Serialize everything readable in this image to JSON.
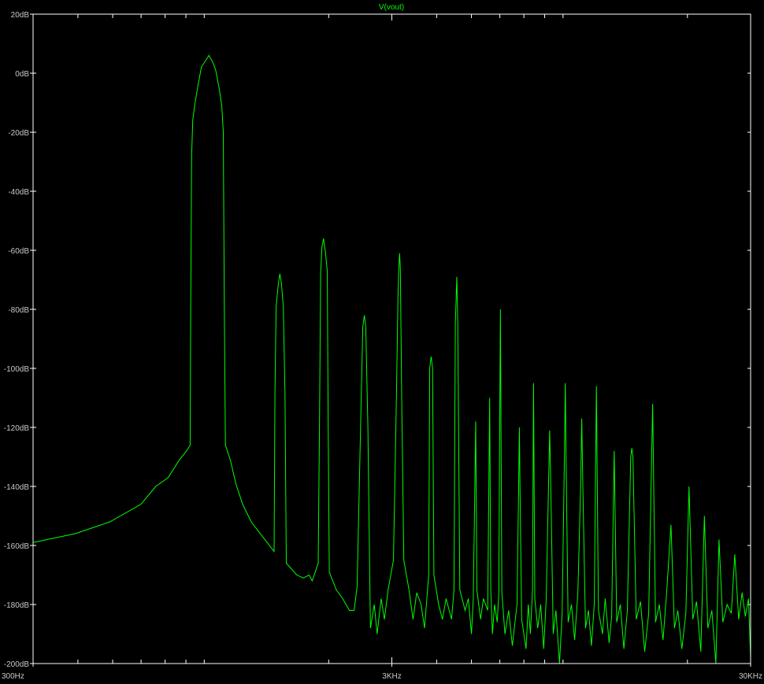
{
  "chart_data": {
    "type": "line",
    "title": "V(vout)",
    "xlabel": "",
    "ylabel": "",
    "x_scale": "log",
    "xlim": [
      300,
      30000
    ],
    "ylim": [
      -200,
      20
    ],
    "x_tick_values": [
      300,
      3000,
      30000
    ],
    "x_tick_labels": [
      "300Hz",
      "3KHz",
      "30KHz"
    ],
    "y_tick_values": [
      20,
      0,
      -20,
      -40,
      -60,
      -80,
      -100,
      -120,
      -140,
      -160,
      -180,
      -200
    ],
    "y_tick_labels": [
      "20dB",
      "0dB",
      "-20dB",
      "-40dB",
      "-60dB",
      "-80dB",
      "-100dB",
      "-120dB",
      "-140dB",
      "-160dB",
      "-180dB",
      "-200dB"
    ],
    "grid": false,
    "background": "#000000",
    "frame_color": "#ffffff",
    "line_color": "#00ff00",
    "series": [
      {
        "name": "V(vout)",
        "points": [
          [
            300,
            -159
          ],
          [
            393,
            -156
          ],
          [
            491,
            -152
          ],
          [
            600,
            -146
          ],
          [
            659,
            -140
          ],
          [
            714,
            -137
          ],
          [
            767,
            -131
          ],
          [
            803,
            -128
          ],
          [
            822,
            -126
          ],
          [
            825,
            -82
          ],
          [
            830,
            -28
          ],
          [
            836,
            -16
          ],
          [
            846,
            -11
          ],
          [
            862,
            -5
          ],
          [
            883,
            2
          ],
          [
            905,
            4
          ],
          [
            927,
            6
          ],
          [
            948,
            4
          ],
          [
            969,
            1
          ],
          [
            990,
            -5
          ],
          [
            1007,
            -11
          ],
          [
            1017,
            -20
          ],
          [
            1024,
            -83
          ],
          [
            1031,
            -126
          ],
          [
            1064,
            -131
          ],
          [
            1102,
            -139
          ],
          [
            1151,
            -146
          ],
          [
            1216,
            -152
          ],
          [
            1309,
            -157
          ],
          [
            1409,
            -162
          ],
          [
            1417,
            -108
          ],
          [
            1428,
            -79
          ],
          [
            1449,
            -71
          ],
          [
            1462,
            -68
          ],
          [
            1476,
            -71
          ],
          [
            1495,
            -79
          ],
          [
            1511,
            -108
          ],
          [
            1524,
            -166
          ],
          [
            1630,
            -170
          ],
          [
            1700,
            -171
          ],
          [
            1764,
            -170
          ],
          [
            1800,
            -172
          ],
          [
            1870,
            -166
          ],
          [
            1885,
            -120
          ],
          [
            1900,
            -68
          ],
          [
            1915,
            -59
          ],
          [
            1935,
            -56
          ],
          [
            1960,
            -61
          ],
          [
            1982,
            -67
          ],
          [
            1994,
            -120
          ],
          [
            2008,
            -169
          ],
          [
            2100,
            -175
          ],
          [
            2188,
            -178
          ],
          [
            2285,
            -182
          ],
          [
            2355,
            -182
          ],
          [
            2400,
            -174
          ],
          [
            2455,
            -120
          ],
          [
            2489,
            -86
          ],
          [
            2515,
            -82
          ],
          [
            2538,
            -86
          ],
          [
            2573,
            -120
          ],
          [
            2614,
            -188
          ],
          [
            2680,
            -180
          ],
          [
            2730,
            -190
          ],
          [
            2800,
            -178
          ],
          [
            2860,
            -185
          ],
          [
            2930,
            -175
          ],
          [
            3030,
            -165
          ],
          [
            3090,
            -110
          ],
          [
            3122,
            -74
          ],
          [
            3138,
            -66
          ],
          [
            3153,
            -61
          ],
          [
            3168,
            -66
          ],
          [
            3195,
            -110
          ],
          [
            3240,
            -165
          ],
          [
            3350,
            -175
          ],
          [
            3437,
            -185
          ],
          [
            3520,
            -176
          ],
          [
            3620,
            -180
          ],
          [
            3700,
            -188
          ],
          [
            3800,
            -170
          ],
          [
            3825,
            -100
          ],
          [
            3860,
            -96
          ],
          [
            3896,
            -100
          ],
          [
            3930,
            -170
          ],
          [
            4050,
            -180
          ],
          [
            4150,
            -185
          ],
          [
            4250,
            -178
          ],
          [
            4400,
            -185
          ],
          [
            4470,
            -175
          ],
          [
            4510,
            -85
          ],
          [
            4553,
            -69
          ],
          [
            4580,
            -85
          ],
          [
            4640,
            -175
          ],
          [
            4800,
            -182
          ],
          [
            4900,
            -178
          ],
          [
            5000,
            -190
          ],
          [
            5060,
            -178
          ],
          [
            5140,
            -118
          ],
          [
            5180,
            -175
          ],
          [
            5300,
            -185
          ],
          [
            5400,
            -178
          ],
          [
            5550,
            -182
          ],
          [
            5620,
            -110
          ],
          [
            5660,
            -175
          ],
          [
            5720,
            -190
          ],
          [
            5800,
            -180
          ],
          [
            5900,
            -186
          ],
          [
            5960,
            -176
          ],
          [
            6020,
            -80
          ],
          [
            6080,
            -176
          ],
          [
            6200,
            -190
          ],
          [
            6350,
            -182
          ],
          [
            6500,
            -194
          ],
          [
            6700,
            -180
          ],
          [
            6770,
            -140
          ],
          [
            6800,
            -120
          ],
          [
            6830,
            -140
          ],
          [
            6900,
            -185
          ],
          [
            7100,
            -195
          ],
          [
            7200,
            -180
          ],
          [
            7300,
            -190
          ],
          [
            7400,
            -175
          ],
          [
            7450,
            -105
          ],
          [
            7510,
            -178
          ],
          [
            7650,
            -188
          ],
          [
            7800,
            -180
          ],
          [
            7950,
            -195
          ],
          [
            8080,
            -178
          ],
          [
            8200,
            -140
          ],
          [
            8260,
            -121
          ],
          [
            8320,
            -140
          ],
          [
            8450,
            -190
          ],
          [
            8600,
            -182
          ],
          [
            8800,
            -200
          ],
          [
            8950,
            -183
          ],
          [
            9080,
            -130
          ],
          [
            9130,
            -105
          ],
          [
            9180,
            -130
          ],
          [
            9300,
            -186
          ],
          [
            9500,
            -180
          ],
          [
            9700,
            -192
          ],
          [
            9900,
            -176
          ],
          [
            10080,
            -140
          ],
          [
            10150,
            -117
          ],
          [
            10220,
            -140
          ],
          [
            10400,
            -188
          ],
          [
            10600,
            -182
          ],
          [
            10800,
            -194
          ],
          [
            11000,
            -180
          ],
          [
            11150,
            -106
          ],
          [
            11300,
            -182
          ],
          [
            11600,
            -190
          ],
          [
            11800,
            -178
          ],
          [
            12100,
            -193
          ],
          [
            12300,
            -184
          ],
          [
            12500,
            -128
          ],
          [
            12700,
            -186
          ],
          [
            13000,
            -180
          ],
          [
            13300,
            -195
          ],
          [
            13600,
            -182
          ],
          [
            13900,
            -130
          ],
          [
            14000,
            -127
          ],
          [
            14100,
            -130
          ],
          [
            14400,
            -185
          ],
          [
            14800,
            -179
          ],
          [
            15200,
            -196
          ],
          [
            15600,
            -183
          ],
          [
            16000,
            -112
          ],
          [
            16300,
            -186
          ],
          [
            16700,
            -180
          ],
          [
            17100,
            -192
          ],
          [
            17500,
            -176
          ],
          [
            18000,
            -153
          ],
          [
            18400,
            -188
          ],
          [
            18800,
            -182
          ],
          [
            19300,
            -195
          ],
          [
            19800,
            -183
          ],
          [
            20200,
            -140
          ],
          [
            20700,
            -185
          ],
          [
            21200,
            -179
          ],
          [
            21800,
            -196
          ],
          [
            22300,
            -150
          ],
          [
            22800,
            -188
          ],
          [
            23400,
            -182
          ],
          [
            24000,
            -200
          ],
          [
            24500,
            -158
          ],
          [
            25100,
            -186
          ],
          [
            25800,
            -180
          ],
          [
            26500,
            -183
          ],
          [
            27100,
            -163
          ],
          [
            27800,
            -185
          ],
          [
            28400,
            -176
          ],
          [
            29000,
            -184
          ],
          [
            29600,
            -178
          ],
          [
            30000,
            -198
          ]
        ]
      }
    ]
  }
}
